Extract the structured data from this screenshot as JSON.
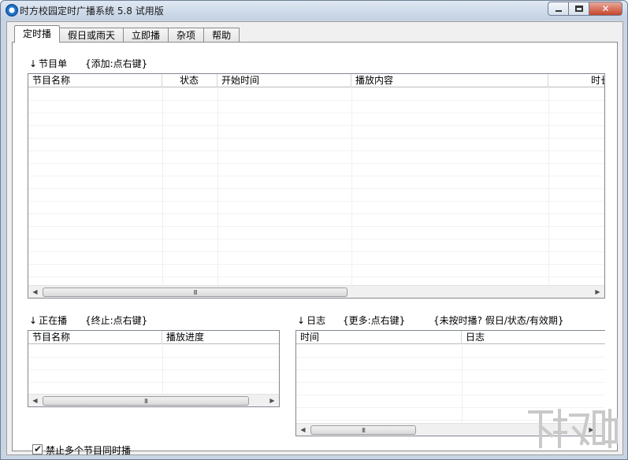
{
  "window": {
    "title": "时方校园定时广播系统 5.8 试用版",
    "close_label": "✕"
  },
  "tabs": [
    {
      "label": "定时播",
      "active": true
    },
    {
      "label": "假日或雨天",
      "active": false
    },
    {
      "label": "立即播",
      "active": false
    },
    {
      "label": "杂项",
      "active": false
    },
    {
      "label": "帮助",
      "active": false
    }
  ],
  "program_list": {
    "heading": "节目单",
    "hint": "{添加:点右键}",
    "columns": [
      "节目名称",
      "状态",
      "开始时间",
      "播放内容",
      "时长"
    ]
  },
  "now_playing": {
    "heading": "正在播",
    "hint": "{终止:点右键}",
    "columns": [
      "节目名称",
      "播放进度"
    ]
  },
  "log": {
    "heading": "日志",
    "hint": "{更多:点右键}",
    "hint2": "{未按时播? 假日/状态/有效期}",
    "columns": [
      "时间",
      "日志"
    ]
  },
  "options": {
    "no_simultaneous_label": "禁止多个节目同时播",
    "no_simultaneous_checked": true
  },
  "scrollbar": {
    "grip": "III",
    "left_arrow": "◀",
    "right_arrow": "▶"
  },
  "watermark": {
    "text": "下载吧"
  }
}
